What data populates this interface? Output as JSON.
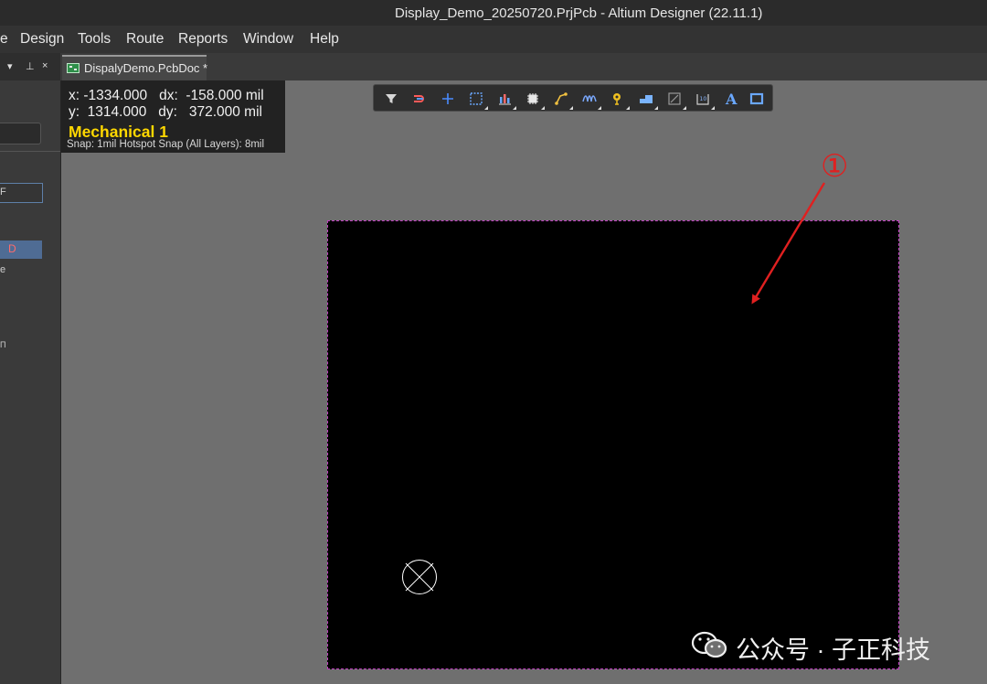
{
  "window": {
    "title": "Display_Demo_20250720.PrjPcb - Altium Designer (22.11.1)"
  },
  "menu": {
    "items": [
      "e",
      "Design",
      "Tools",
      "Route",
      "Reports",
      "Window",
      "Help"
    ]
  },
  "panel": {
    "header_controls": [
      "▾",
      "⊥",
      "×"
    ],
    "selected_text": "D",
    "fragments": [
      "F",
      "e",
      "Π"
    ]
  },
  "document_tab": {
    "label": "DispalyDemo.PcbDoc *"
  },
  "hud": {
    "x_line": "x: -1334.000   dx:  -158.000 mil",
    "y_line": "y:  1314.000   dy:   372.000 mil",
    "layer": "Mechanical 1",
    "snap": "Snap: 1mil Hotspot Snap (All Layers): 8mil"
  },
  "toolbar": {
    "icons": [
      "filter-icon",
      "route-icon",
      "crosshair-icon",
      "select-rect-icon",
      "align-icon",
      "component-icon",
      "interactive-route-icon",
      "tune-icon",
      "via-icon",
      "fill-icon",
      "region-icon",
      "dimension-icon",
      "text-icon",
      "rectangle-icon"
    ],
    "text_glyph": "A"
  },
  "annotation": {
    "marker": "①",
    "color": "#e02020"
  },
  "watermark": {
    "text": "公众号 · 子正科技"
  },
  "colors": {
    "board": "#000000",
    "board_outline": "#c040c0",
    "layer_label": "#ffd800",
    "canvas": "#6f6f6f"
  }
}
